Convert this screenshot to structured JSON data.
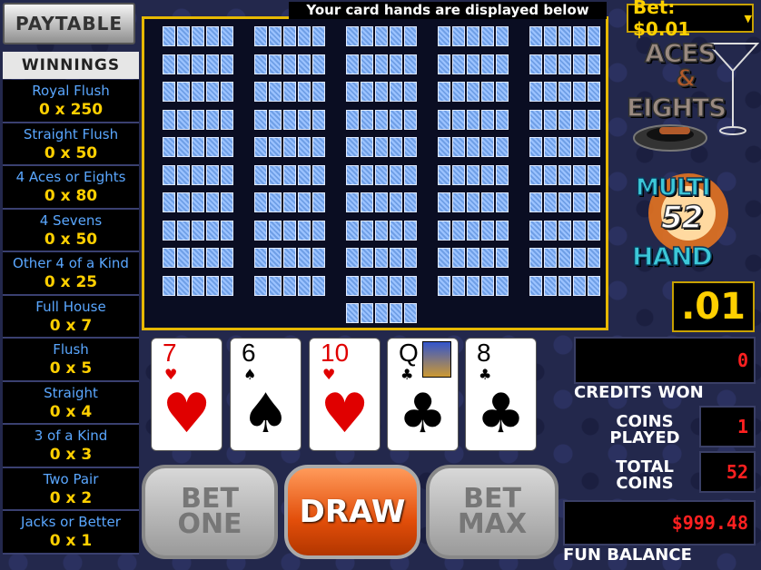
{
  "paytable_button": "PAYTABLE",
  "winnings_header": "WINNINGS",
  "paytable": [
    {
      "name": "Royal Flush",
      "value": "0 x 250"
    },
    {
      "name": "Straight Flush",
      "value": "0 x 50"
    },
    {
      "name": "4 Aces or Eights",
      "value": "0 x 80"
    },
    {
      "name": "4 Sevens",
      "value": "0 x 50"
    },
    {
      "name": "Other 4 of a Kind",
      "value": "0 x 25"
    },
    {
      "name": "Full House",
      "value": "0 x 7"
    },
    {
      "name": "Flush",
      "value": "0 x 5"
    },
    {
      "name": "Straight",
      "value": "0 x 4"
    },
    {
      "name": "3 of a Kind",
      "value": "0 x 3"
    },
    {
      "name": "Two Pair",
      "value": "0 x 2"
    },
    {
      "name": "Jacks or Better",
      "value": "0 x 1"
    }
  ],
  "hands_message": "Your card hands are displayed below",
  "bet_display": "Bet: $0.01",
  "logo": {
    "line1": "ACES",
    "amp": "&",
    "line2": "EIGHTS",
    "multi": "MULTI",
    "number": "52",
    "hand": "HAND"
  },
  "denomination": ".01",
  "cards": [
    {
      "rank": "7",
      "suit": "♥",
      "color": "red"
    },
    {
      "rank": "6",
      "suit": "♠",
      "color": "black"
    },
    {
      "rank": "10",
      "suit": "♥",
      "color": "red"
    },
    {
      "rank": "Q",
      "suit": "♣",
      "color": "black"
    },
    {
      "rank": "8",
      "suit": "♣",
      "color": "black"
    }
  ],
  "credits_won": {
    "label": "CREDITS WON",
    "value": "0"
  },
  "coins_played": {
    "label_line1": "COINS",
    "label_line2": "PLAYED",
    "value": "1"
  },
  "total_coins": {
    "label_line1": "TOTAL",
    "label_line2": "COINS",
    "value": "52"
  },
  "fun_balance": {
    "label": "FUN BALANCE",
    "value": "$999.48"
  },
  "buttons": {
    "bet_one_line1": "BET",
    "bet_one_line2": "ONE",
    "draw": "DRAW",
    "bet_max_line1": "BET",
    "bet_max_line2": "MAX"
  },
  "colors": {
    "gold": "#ffd000",
    "blue_text": "#5aa7ff",
    "red_text": "#ff2020",
    "draw_orange": "#e24e0a"
  }
}
